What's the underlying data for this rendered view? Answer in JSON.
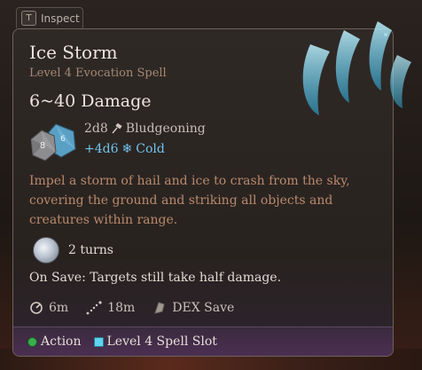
{
  "inspect": {
    "key": "T",
    "label": "Inspect"
  },
  "spell": {
    "name": "Ice Storm",
    "subtitle": "Level 4 Evocation Spell",
    "damage_range": "6~40 Damage",
    "damage_lines": [
      {
        "dice": "2d8",
        "type": "Bludgeoning",
        "icon": "hammer-icon"
      },
      {
        "dice": "+4d6",
        "type": "Cold",
        "icon": "snowflake-icon"
      }
    ],
    "dice_faces": [
      "8",
      "6"
    ],
    "description": "Impel a storm of hail and ice to crash from the sky, covering the ground and striking all objects and creatures within range.",
    "duration": "2 turns",
    "on_save": "On Save: Targets still take half damage.",
    "stats": {
      "range": "6m",
      "area": "18m",
      "save": "DEX Save"
    },
    "costs": {
      "action": "Action",
      "slot": "Level 4 Spell Slot"
    }
  },
  "colors": {
    "cold": "#71c3ec",
    "description": "#b98a6b",
    "subtitle": "#a48a75",
    "action_dot": "#37b04d",
    "slot_square": "#5fd3f0"
  }
}
